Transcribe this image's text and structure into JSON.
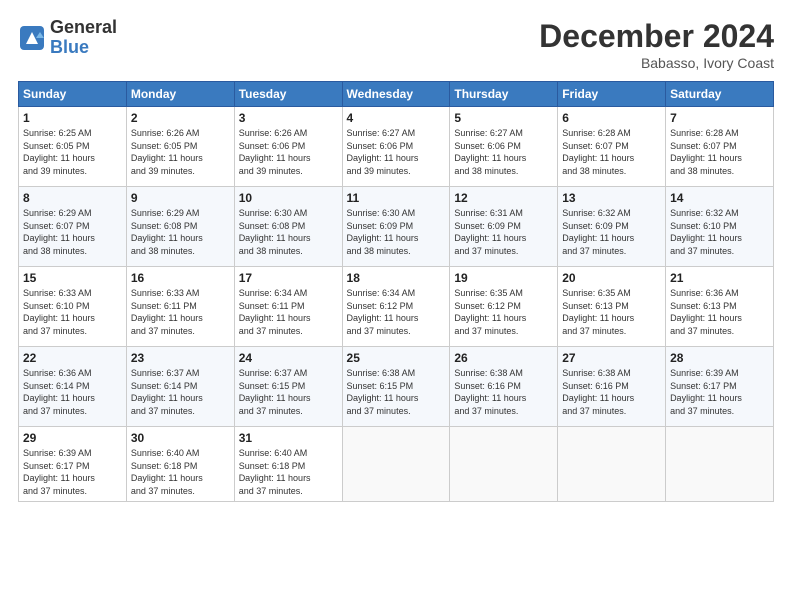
{
  "header": {
    "logo_general": "General",
    "logo_blue": "Blue",
    "month_title": "December 2024",
    "location": "Babasso, Ivory Coast"
  },
  "days_of_week": [
    "Sunday",
    "Monday",
    "Tuesday",
    "Wednesday",
    "Thursday",
    "Friday",
    "Saturday"
  ],
  "weeks": [
    [
      {
        "day": 1,
        "info": "Sunrise: 6:25 AM\nSunset: 6:05 PM\nDaylight: 11 hours\nand 39 minutes."
      },
      {
        "day": 2,
        "info": "Sunrise: 6:26 AM\nSunset: 6:05 PM\nDaylight: 11 hours\nand 39 minutes."
      },
      {
        "day": 3,
        "info": "Sunrise: 6:26 AM\nSunset: 6:06 PM\nDaylight: 11 hours\nand 39 minutes."
      },
      {
        "day": 4,
        "info": "Sunrise: 6:27 AM\nSunset: 6:06 PM\nDaylight: 11 hours\nand 39 minutes."
      },
      {
        "day": 5,
        "info": "Sunrise: 6:27 AM\nSunset: 6:06 PM\nDaylight: 11 hours\nand 38 minutes."
      },
      {
        "day": 6,
        "info": "Sunrise: 6:28 AM\nSunset: 6:07 PM\nDaylight: 11 hours\nand 38 minutes."
      },
      {
        "day": 7,
        "info": "Sunrise: 6:28 AM\nSunset: 6:07 PM\nDaylight: 11 hours\nand 38 minutes."
      }
    ],
    [
      {
        "day": 8,
        "info": "Sunrise: 6:29 AM\nSunset: 6:07 PM\nDaylight: 11 hours\nand 38 minutes."
      },
      {
        "day": 9,
        "info": "Sunrise: 6:29 AM\nSunset: 6:08 PM\nDaylight: 11 hours\nand 38 minutes."
      },
      {
        "day": 10,
        "info": "Sunrise: 6:30 AM\nSunset: 6:08 PM\nDaylight: 11 hours\nand 38 minutes."
      },
      {
        "day": 11,
        "info": "Sunrise: 6:30 AM\nSunset: 6:09 PM\nDaylight: 11 hours\nand 38 minutes."
      },
      {
        "day": 12,
        "info": "Sunrise: 6:31 AM\nSunset: 6:09 PM\nDaylight: 11 hours\nand 37 minutes."
      },
      {
        "day": 13,
        "info": "Sunrise: 6:32 AM\nSunset: 6:09 PM\nDaylight: 11 hours\nand 37 minutes."
      },
      {
        "day": 14,
        "info": "Sunrise: 6:32 AM\nSunset: 6:10 PM\nDaylight: 11 hours\nand 37 minutes."
      }
    ],
    [
      {
        "day": 15,
        "info": "Sunrise: 6:33 AM\nSunset: 6:10 PM\nDaylight: 11 hours\nand 37 minutes."
      },
      {
        "day": 16,
        "info": "Sunrise: 6:33 AM\nSunset: 6:11 PM\nDaylight: 11 hours\nand 37 minutes."
      },
      {
        "day": 17,
        "info": "Sunrise: 6:34 AM\nSunset: 6:11 PM\nDaylight: 11 hours\nand 37 minutes."
      },
      {
        "day": 18,
        "info": "Sunrise: 6:34 AM\nSunset: 6:12 PM\nDaylight: 11 hours\nand 37 minutes."
      },
      {
        "day": 19,
        "info": "Sunrise: 6:35 AM\nSunset: 6:12 PM\nDaylight: 11 hours\nand 37 minutes."
      },
      {
        "day": 20,
        "info": "Sunrise: 6:35 AM\nSunset: 6:13 PM\nDaylight: 11 hours\nand 37 minutes."
      },
      {
        "day": 21,
        "info": "Sunrise: 6:36 AM\nSunset: 6:13 PM\nDaylight: 11 hours\nand 37 minutes."
      }
    ],
    [
      {
        "day": 22,
        "info": "Sunrise: 6:36 AM\nSunset: 6:14 PM\nDaylight: 11 hours\nand 37 minutes."
      },
      {
        "day": 23,
        "info": "Sunrise: 6:37 AM\nSunset: 6:14 PM\nDaylight: 11 hours\nand 37 minutes."
      },
      {
        "day": 24,
        "info": "Sunrise: 6:37 AM\nSunset: 6:15 PM\nDaylight: 11 hours\nand 37 minutes."
      },
      {
        "day": 25,
        "info": "Sunrise: 6:38 AM\nSunset: 6:15 PM\nDaylight: 11 hours\nand 37 minutes."
      },
      {
        "day": 26,
        "info": "Sunrise: 6:38 AM\nSunset: 6:16 PM\nDaylight: 11 hours\nand 37 minutes."
      },
      {
        "day": 27,
        "info": "Sunrise: 6:38 AM\nSunset: 6:16 PM\nDaylight: 11 hours\nand 37 minutes."
      },
      {
        "day": 28,
        "info": "Sunrise: 6:39 AM\nSunset: 6:17 PM\nDaylight: 11 hours\nand 37 minutes."
      }
    ],
    [
      {
        "day": 29,
        "info": "Sunrise: 6:39 AM\nSunset: 6:17 PM\nDaylight: 11 hours\nand 37 minutes."
      },
      {
        "day": 30,
        "info": "Sunrise: 6:40 AM\nSunset: 6:18 PM\nDaylight: 11 hours\nand 37 minutes."
      },
      {
        "day": 31,
        "info": "Sunrise: 6:40 AM\nSunset: 6:18 PM\nDaylight: 11 hours\nand 37 minutes."
      },
      null,
      null,
      null,
      null
    ]
  ]
}
